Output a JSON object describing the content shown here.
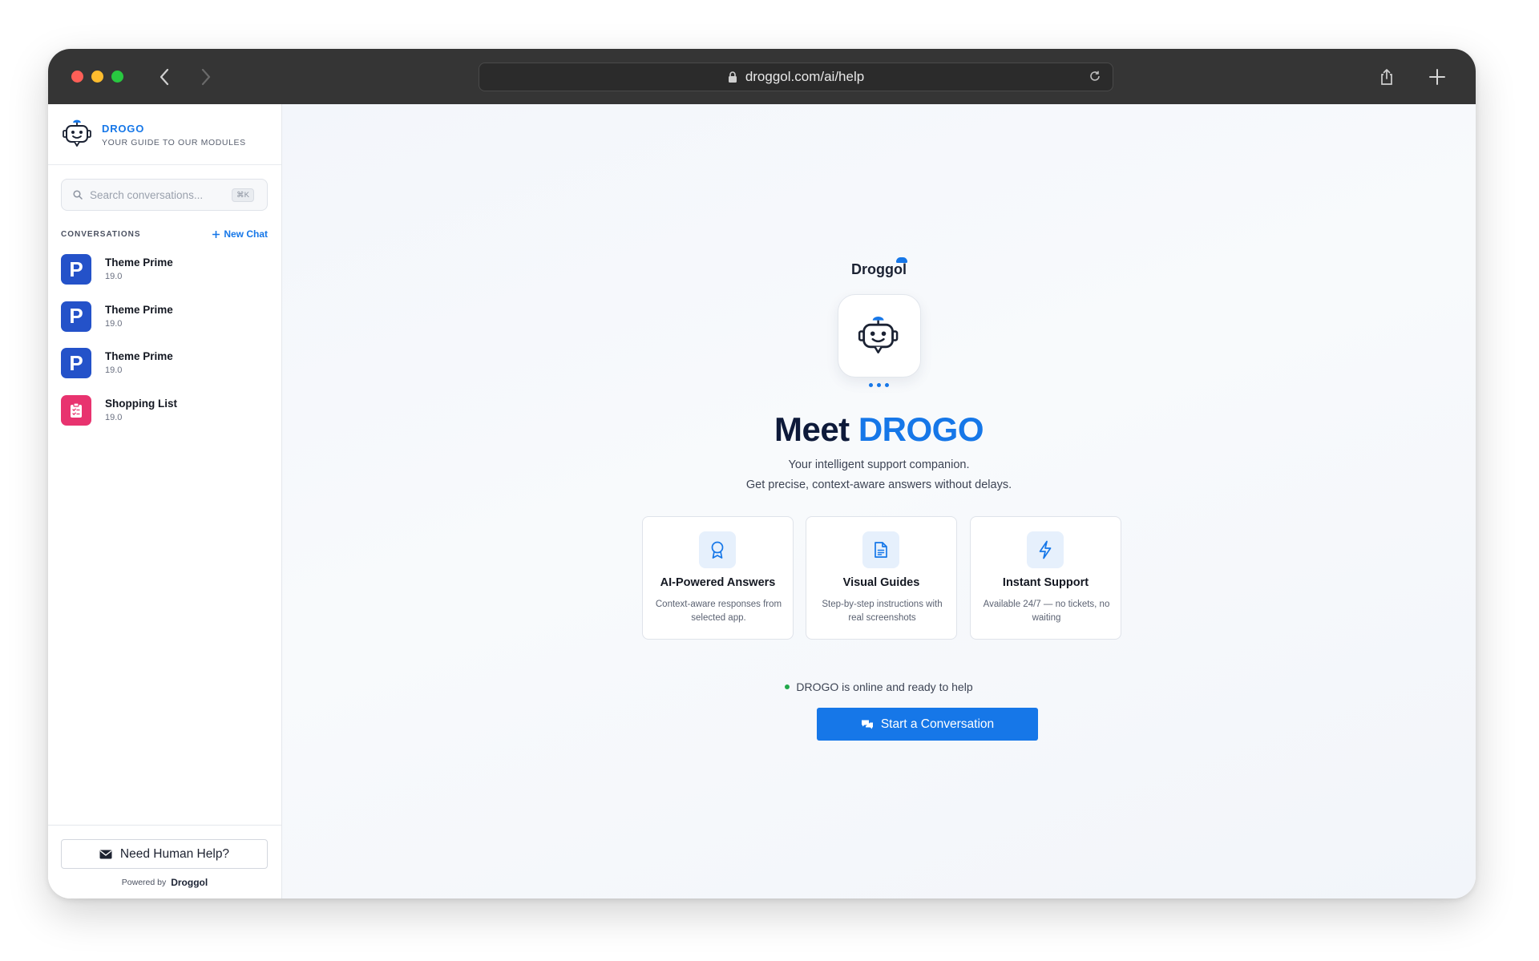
{
  "browser": {
    "url": "droggol.com/ai/help"
  },
  "sidebar": {
    "brand_name": "DROGO",
    "brand_tagline": "YOUR GUIDE TO OUR MODULES",
    "search_placeholder": "Search conversations...",
    "search_shortcut": "⌘K",
    "conversations_heading": "CONVERSATIONS",
    "new_chat_label": "New Chat",
    "conversations": [
      {
        "icon_letter": "P",
        "icon_color": "#2452c9",
        "title": "Theme Prime",
        "version": "19.0"
      },
      {
        "icon_letter": "P",
        "icon_color": "#2452c9",
        "title": "Theme Prime",
        "version": "19.0"
      },
      {
        "icon_letter": "P",
        "icon_color": "#2452c9",
        "title": "Theme Prime",
        "version": "19.0"
      },
      {
        "icon_letter": "",
        "icon_name": "clipboard-list-icon",
        "icon_color": "#e8336f",
        "title": "Shopping List",
        "version": "19.0"
      }
    ],
    "human_help_label": "Need Human Help?",
    "powered_by_label": "Powered by",
    "powered_by_brand": "Droggol"
  },
  "main": {
    "wordmark": "Droggol",
    "headline_prefix": "Meet",
    "headline_accent": "DROGO",
    "subtitle_line1": "Your intelligent support companion.",
    "subtitle_line2": "Get precise, context-aware answers without delays.",
    "features": [
      {
        "icon_name": "award-ribbon-icon",
        "title": "AI-Powered Answers",
        "description": "Context-aware responses from selected app."
      },
      {
        "icon_name": "document-icon",
        "title": "Visual Guides",
        "description": "Step-by-step instructions with real screenshots"
      },
      {
        "icon_name": "lightning-bolt-icon",
        "title": "Instant Support",
        "description": "Available 24/7 — no tickets, no waiting"
      }
    ],
    "status_text": "DROGO is online and ready to help",
    "status_color": "#22a84b",
    "cta_label": "Start a Conversation"
  },
  "colors": {
    "accent": "#1677e8",
    "titlebar": "#353535",
    "headline": "#0e1a3a"
  }
}
